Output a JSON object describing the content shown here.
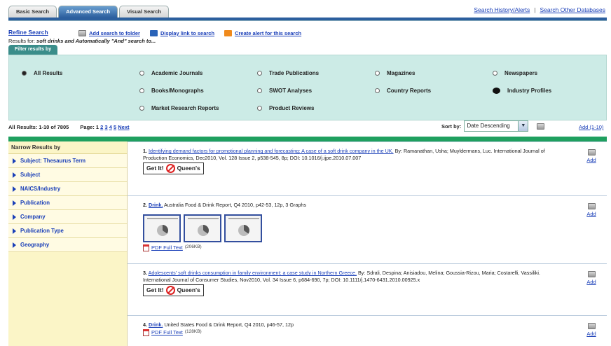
{
  "tabs": [
    "Basic Search",
    "Advanced Search",
    "Visual Search"
  ],
  "top_links": {
    "history": "Search History/Alerts",
    "other_db": "Search Other Databases"
  },
  "refine": {
    "title": "Refine Search",
    "add_folder": "Add search to folder",
    "display_link": "Display link to search",
    "create_alert": "Create alert for this search"
  },
  "results_for": {
    "prefix": "Results for:",
    "query": "soft drinks and Automatically \"And\" search to..."
  },
  "filter": {
    "tab": "Filter results by",
    "options": [
      "All Results",
      "Academic Journals",
      "Trade Publications",
      "Magazines",
      "Newspapers",
      "Books/Monographs",
      "SWOT Analyses",
      "Country Reports",
      "Industry Profiles",
      "Market Research Reports",
      "Product Reviews"
    ]
  },
  "summary": {
    "count": "All Results: 1-10 of 7805",
    "page_label": "Page: 1",
    "pages": [
      "2",
      "3",
      "4",
      "5"
    ],
    "next": "Next"
  },
  "sort": {
    "label": "Sort by:",
    "value": "Date Descending",
    "add_range": "Add (1-10)"
  },
  "sidebar": {
    "title": "Narrow Results by",
    "items": [
      "Subject: Thesaurus Term",
      "Subject",
      "NAICS/Industry",
      "Publication",
      "Company",
      "Publication Type",
      "Geography"
    ]
  },
  "results": [
    {
      "num": "1.",
      "title": "Identifying demand factors for promotional planning and forecasting: A case of a soft drink company in the UK.",
      "meta": "By: Ramanathan, Usha; Muyldermans, Luc. International Journal of Production Economics, Dec2010, Vol. 128 Issue 2, p538-545, 8p; DOI: 10.1016/j.ijpe.2010.07.007",
      "getit": "Get It!",
      "queens": "Queen's"
    },
    {
      "num": "2.",
      "title": "Drink.",
      "meta": "Australia Food & Drink Report, Q4 2010, p42-53, 12p, 3 Graphs",
      "pdf": "PDF Full Text",
      "size": "(206KB)"
    },
    {
      "num": "3.",
      "title": "Adolescents' soft drinks consumption in family environment: a case study in Northern Greece.",
      "meta": "By: Sdrali, Despina; Anisiadou, Melina; Goussia-Rizou, Maria; Costarelli, Vassiliki. International Journal of Consumer Studies, Nov2010, Vol. 34 Issue 6, p684-690, 7p; DOI: 10.1111/j.1470-6431.2010.00925.x",
      "getit": "Get It!",
      "queens": "Queen's"
    },
    {
      "num": "4.",
      "title": "Drink.",
      "meta": "United States Food & Drink Report, Q4 2010, p46-57, 12p",
      "pdf": "PDF Full Text",
      "size": "(128KB)"
    }
  ],
  "add_label": "Add"
}
